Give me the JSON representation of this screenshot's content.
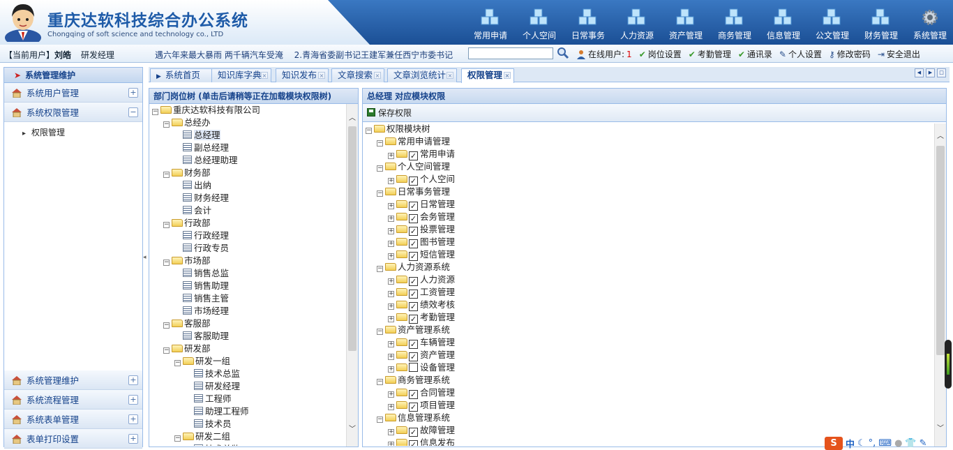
{
  "header": {
    "title": "重庆达软科技综合办公系统",
    "subtitle": "Chongqing of soft science and technology co., LTD",
    "nav": [
      {
        "label": "常用申请",
        "icon": "cubes-icon"
      },
      {
        "label": "个人空间",
        "icon": "cubes-icon"
      },
      {
        "label": "日常事务",
        "icon": "cubes-icon"
      },
      {
        "label": "人力资源",
        "icon": "cubes-icon"
      },
      {
        "label": "资产管理",
        "icon": "cubes-icon"
      },
      {
        "label": "商务管理",
        "icon": "cubes-icon"
      },
      {
        "label": "信息管理",
        "icon": "cubes-icon"
      },
      {
        "label": "公文管理",
        "icon": "cubes-icon"
      },
      {
        "label": "财务管理",
        "icon": "cubes-icon"
      },
      {
        "label": "系统管理",
        "icon": "gear-icon"
      }
    ]
  },
  "infobar": {
    "current_user_label": "【当前用户】",
    "user_name": "刘皓",
    "role": "研发经理",
    "news": [
      "遇六年来最大暴雨 两千辆汽车受淹",
      "2.青海省委副书记王建军兼任西宁市委书记"
    ],
    "search_value": "",
    "links": {
      "online_label": "在线用户:",
      "online_count": "1",
      "post": "岗位设置",
      "attendance": "考勤管理",
      "contacts": "通讯录",
      "personal": "个人设置",
      "password": "修改密码",
      "logout": "安全退出"
    }
  },
  "sidebar": {
    "title": "系统管理维护",
    "top_items": [
      {
        "label": "系统用户管理",
        "toggle": "+"
      },
      {
        "label": "系统权限管理",
        "toggle": "−"
      }
    ],
    "sub_items": [
      "权限管理"
    ],
    "bottom_items": [
      {
        "label": "系统管理维护",
        "toggle": "+"
      },
      {
        "label": "系统流程管理",
        "toggle": "+"
      },
      {
        "label": "系统表单管理",
        "toggle": "+"
      },
      {
        "label": "表单打印设置",
        "toggle": "+"
      }
    ]
  },
  "tabs": [
    {
      "label": "系统首页"
    },
    {
      "label": "知识库字典"
    },
    {
      "label": "知识发布"
    },
    {
      "label": "文章搜索"
    },
    {
      "label": "文章浏览统计"
    },
    {
      "label": "权限管理",
      "active": true
    }
  ],
  "left_panel": {
    "title": "部门岗位树 (单击后请稍等正在加载模块权限树)",
    "tree": [
      {
        "label": "重庆达软科技有限公司",
        "level": 0,
        "type": "folder",
        "pm": "⊟"
      },
      {
        "label": "总经办",
        "level": 1,
        "type": "folder",
        "pm": "⊟"
      },
      {
        "label": "总经理",
        "level": 2,
        "type": "leaf",
        "selected": true
      },
      {
        "label": "副总经理",
        "level": 2,
        "type": "leaf"
      },
      {
        "label": "总经理助理",
        "level": 2,
        "type": "leaf"
      },
      {
        "label": "财务部",
        "level": 1,
        "type": "folder",
        "pm": "⊟"
      },
      {
        "label": "出纳",
        "level": 2,
        "type": "leaf"
      },
      {
        "label": "财务经理",
        "level": 2,
        "type": "leaf"
      },
      {
        "label": "会计",
        "level": 2,
        "type": "leaf"
      },
      {
        "label": "行政部",
        "level": 1,
        "type": "folder",
        "pm": "⊟"
      },
      {
        "label": "行政经理",
        "level": 2,
        "type": "leaf"
      },
      {
        "label": "行政专员",
        "level": 2,
        "type": "leaf"
      },
      {
        "label": "市场部",
        "level": 1,
        "type": "folder",
        "pm": "⊟"
      },
      {
        "label": "销售总监",
        "level": 2,
        "type": "leaf"
      },
      {
        "label": "销售助理",
        "level": 2,
        "type": "leaf"
      },
      {
        "label": "销售主管",
        "level": 2,
        "type": "leaf"
      },
      {
        "label": "市场经理",
        "level": 2,
        "type": "leaf"
      },
      {
        "label": "客服部",
        "level": 1,
        "type": "folder",
        "pm": "⊟"
      },
      {
        "label": "客服助理",
        "level": 2,
        "type": "leaf"
      },
      {
        "label": "研发部",
        "level": 1,
        "type": "folder",
        "pm": "⊟"
      },
      {
        "label": "研发一组",
        "level": 2,
        "type": "folder",
        "pm": "⊟"
      },
      {
        "label": "技术总监",
        "level": 3,
        "type": "leaf"
      },
      {
        "label": "研发经理",
        "level": 3,
        "type": "leaf"
      },
      {
        "label": "工程师",
        "level": 3,
        "type": "leaf"
      },
      {
        "label": "助理工程师",
        "level": 3,
        "type": "leaf"
      },
      {
        "label": "技术员",
        "level": 3,
        "type": "leaf"
      },
      {
        "label": "研发二组",
        "level": 2,
        "type": "folder",
        "pm": "⊟"
      },
      {
        "label": "技术总监",
        "level": 3,
        "type": "leaf"
      }
    ]
  },
  "right_panel": {
    "title": "总经理 对应模块权限",
    "save_label": "保存权限",
    "tree": [
      {
        "label": "权限模块树",
        "level": 0,
        "type": "folder",
        "pm": "⊟"
      },
      {
        "label": "常用申请管理",
        "level": 1,
        "type": "folder",
        "pm": "⊟"
      },
      {
        "label": "常用申请",
        "level": 2,
        "type": "check",
        "checked": true,
        "pm": "⊞"
      },
      {
        "label": "个人空间管理",
        "level": 1,
        "type": "folder",
        "pm": "⊟"
      },
      {
        "label": "个人空间",
        "level": 2,
        "type": "check",
        "checked": true,
        "pm": "⊞"
      },
      {
        "label": "日常事务管理",
        "level": 1,
        "type": "folder",
        "pm": "⊟"
      },
      {
        "label": "日常管理",
        "level": 2,
        "type": "check",
        "checked": true,
        "pm": "⊞"
      },
      {
        "label": "会务管理",
        "level": 2,
        "type": "check",
        "checked": true,
        "pm": "⊞"
      },
      {
        "label": "投票管理",
        "level": 2,
        "type": "check",
        "checked": true,
        "pm": "⊞"
      },
      {
        "label": "图书管理",
        "level": 2,
        "type": "check",
        "checked": true,
        "pm": "⊞"
      },
      {
        "label": "短信管理",
        "level": 2,
        "type": "check",
        "checked": true,
        "pm": "⊞"
      },
      {
        "label": "人力资源系统",
        "level": 1,
        "type": "folder",
        "pm": "⊟"
      },
      {
        "label": "人力资源",
        "level": 2,
        "type": "check",
        "checked": true,
        "pm": "⊞"
      },
      {
        "label": "工资管理",
        "level": 2,
        "type": "check",
        "checked": true,
        "pm": "⊞"
      },
      {
        "label": "绩效考核",
        "level": 2,
        "type": "check",
        "checked": true,
        "pm": "⊞"
      },
      {
        "label": "考勤管理",
        "level": 2,
        "type": "check",
        "checked": true,
        "pm": "⊞"
      },
      {
        "label": "资产管理系统",
        "level": 1,
        "type": "folder",
        "pm": "⊟"
      },
      {
        "label": "车辆管理",
        "level": 2,
        "type": "check",
        "checked": true,
        "pm": "⊞"
      },
      {
        "label": "资产管理",
        "level": 2,
        "type": "check",
        "checked": true,
        "pm": "⊞"
      },
      {
        "label": "设备管理",
        "level": 2,
        "type": "check",
        "checked": false,
        "pm": "⊞"
      },
      {
        "label": "商务管理系统",
        "level": 1,
        "type": "folder",
        "pm": "⊟"
      },
      {
        "label": "合同管理",
        "level": 2,
        "type": "check",
        "checked": true,
        "pm": "⊞"
      },
      {
        "label": "项目管理",
        "level": 2,
        "type": "check",
        "checked": true,
        "pm": "⊞"
      },
      {
        "label": "信息管理系统",
        "level": 1,
        "type": "folder",
        "pm": "⊟"
      },
      {
        "label": "故障管理",
        "level": 2,
        "type": "check",
        "checked": true,
        "pm": "⊞"
      },
      {
        "label": "信息发布",
        "level": 2,
        "type": "check",
        "checked": true,
        "pm": "⊞"
      }
    ]
  },
  "ime": {
    "logo": "S",
    "lang": "中"
  },
  "colors": {
    "brand": "#1e5ba8",
    "header_blue": "#1b4f95",
    "panel_border": "#99bbe8",
    "title_text": "#15428b"
  }
}
